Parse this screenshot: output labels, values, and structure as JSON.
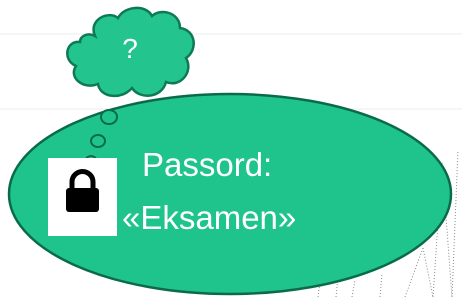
{
  "thought_cloud": {
    "symbol": "?"
  },
  "speech_bubble": {
    "label": "Passord:",
    "value": "«Eksamen»"
  },
  "colors": {
    "bubble_fill": "#1fc48c",
    "bubble_stroke": "#0a6b4b",
    "cloud_fill": "#23c48d",
    "cloud_stroke": "#0e7a55",
    "text": "#ffffff",
    "lock_box": "#ffffff",
    "lock_icon": "#000000",
    "background_line": "#eeeeee",
    "dotted_lines": "#888888"
  },
  "icons": {
    "lock": "lock-icon"
  }
}
